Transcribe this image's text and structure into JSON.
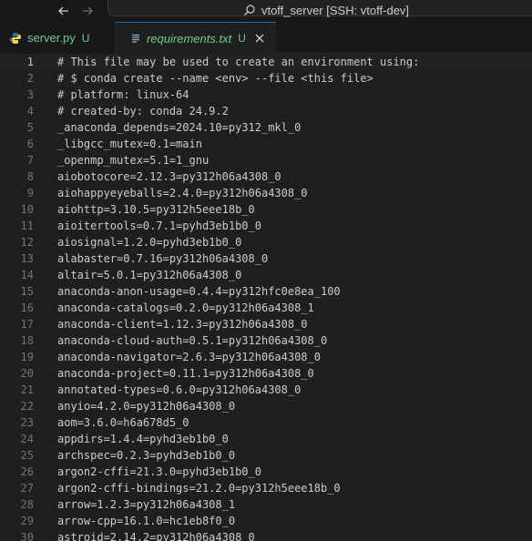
{
  "titlebar": {
    "title": "vtoff_server [SSH: vtoff-dev]",
    "back_icon": "arrow-left-icon",
    "forward_icon": "arrow-right-icon",
    "search_icon": "search-icon"
  },
  "tabs": [
    {
      "label": "server.py",
      "status": "U",
      "icon": "python-icon",
      "active": false
    },
    {
      "label": "requirements.txt",
      "status": "U",
      "icon": "text-file-icon",
      "active": true
    }
  ],
  "colors": {
    "accent": "#0078d4",
    "untracked": "#73c991",
    "python_blue": "#3572a5",
    "python_yellow": "#ffd43b"
  },
  "editor": {
    "active_line": 1,
    "lines": [
      {
        "n": "1",
        "text": "# This file may be used to create an environment using:"
      },
      {
        "n": "2",
        "text": "# $ conda create --name <env> --file <this file>"
      },
      {
        "n": "3",
        "text": "# platform: linux-64"
      },
      {
        "n": "4",
        "text": "# created-by: conda 24.9.2"
      },
      {
        "n": "5",
        "text": "_anaconda_depends=2024.10=py312_mkl_0"
      },
      {
        "n": "6",
        "text": "_libgcc_mutex=0.1=main"
      },
      {
        "n": "7",
        "text": "_openmp_mutex=5.1=1_gnu"
      },
      {
        "n": "8",
        "text": "aiobotocore=2.12.3=py312h06a4308_0"
      },
      {
        "n": "9",
        "text": "aiohappyeyeballs=2.4.0=py312h06a4308_0"
      },
      {
        "n": "10",
        "text": "aiohttp=3.10.5=py312h5eee18b_0"
      },
      {
        "n": "11",
        "text": "aioitertools=0.7.1=pyhd3eb1b0_0"
      },
      {
        "n": "12",
        "text": "aiosignal=1.2.0=pyhd3eb1b0_0"
      },
      {
        "n": "13",
        "text": "alabaster=0.7.16=py312h06a4308_0"
      },
      {
        "n": "14",
        "text": "altair=5.0.1=py312h06a4308_0"
      },
      {
        "n": "15",
        "text": "anaconda-anon-usage=0.4.4=py312hfc0e8ea_100"
      },
      {
        "n": "16",
        "text": "anaconda-catalogs=0.2.0=py312h06a4308_1"
      },
      {
        "n": "17",
        "text": "anaconda-client=1.12.3=py312h06a4308_0"
      },
      {
        "n": "18",
        "text": "anaconda-cloud-auth=0.5.1=py312h06a4308_0"
      },
      {
        "n": "19",
        "text": "anaconda-navigator=2.6.3=py312h06a4308_0"
      },
      {
        "n": "20",
        "text": "anaconda-project=0.11.1=py312h06a4308_0"
      },
      {
        "n": "21",
        "text": "annotated-types=0.6.0=py312h06a4308_0"
      },
      {
        "n": "22",
        "text": "anyio=4.2.0=py312h06a4308_0"
      },
      {
        "n": "23",
        "text": "aom=3.6.0=h6a678d5_0"
      },
      {
        "n": "24",
        "text": "appdirs=1.4.4=pyhd3eb1b0_0"
      },
      {
        "n": "25",
        "text": "archspec=0.2.3=pyhd3eb1b0_0"
      },
      {
        "n": "26",
        "text": "argon2-cffi=21.3.0=pyhd3eb1b0_0"
      },
      {
        "n": "27",
        "text": "argon2-cffi-bindings=21.2.0=py312h5eee18b_0"
      },
      {
        "n": "28",
        "text": "arrow=1.2.3=py312h06a4308_1"
      },
      {
        "n": "29",
        "text": "arrow-cpp=16.1.0=hc1eb8f0_0"
      },
      {
        "n": "30",
        "text": "astroid=2.14.2=py312h06a4308_0"
      }
    ]
  }
}
